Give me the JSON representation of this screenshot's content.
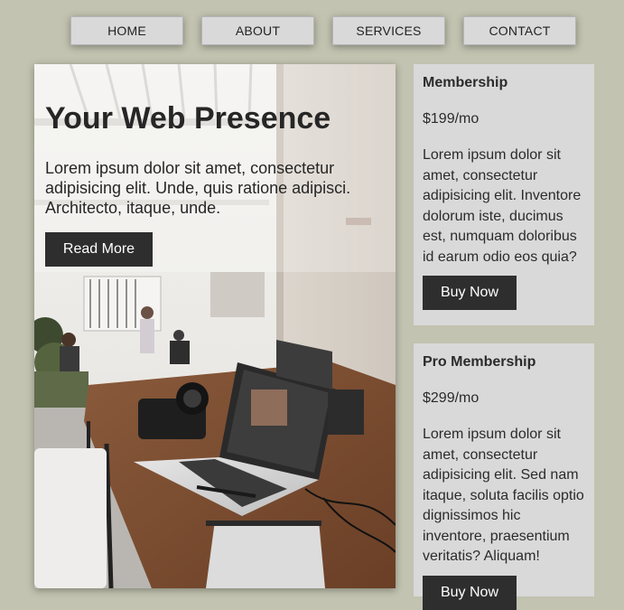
{
  "nav": {
    "items": [
      {
        "label": "HOME"
      },
      {
        "label": "ABOUT"
      },
      {
        "label": "SERVICES"
      },
      {
        "label": "CONTACT"
      }
    ]
  },
  "hero": {
    "title": "Your Web Presence",
    "text": "Lorem ipsum dolor sit amet, consectetur adipisicing elit. Unde, quis ratione adipisci. Architecto, itaque, unde.",
    "button_label": "Read More"
  },
  "plans": [
    {
      "title": "Membership",
      "price": "$199/mo",
      "description": "Lorem ipsum dolor sit amet, consectetur adipisicing elit. Inventore dolorum iste, ducimus est, numquam doloribus id earum odio eos quia?",
      "button_label": "Buy Now"
    },
    {
      "title": "Pro Membership",
      "price": "$299/mo",
      "description": "Lorem ipsum dolor sit amet, consectetur adipisicing elit. Sed nam itaque, soluta facilis optio dignissimos hic inventore, praesentium veritatis? Aliquam!",
      "button_label": "Buy Now"
    }
  ],
  "colors": {
    "page_background": "#c2c3b0",
    "panel": "#d9d9d9",
    "button_dark": "#2e2e2e",
    "text": "#262626"
  }
}
